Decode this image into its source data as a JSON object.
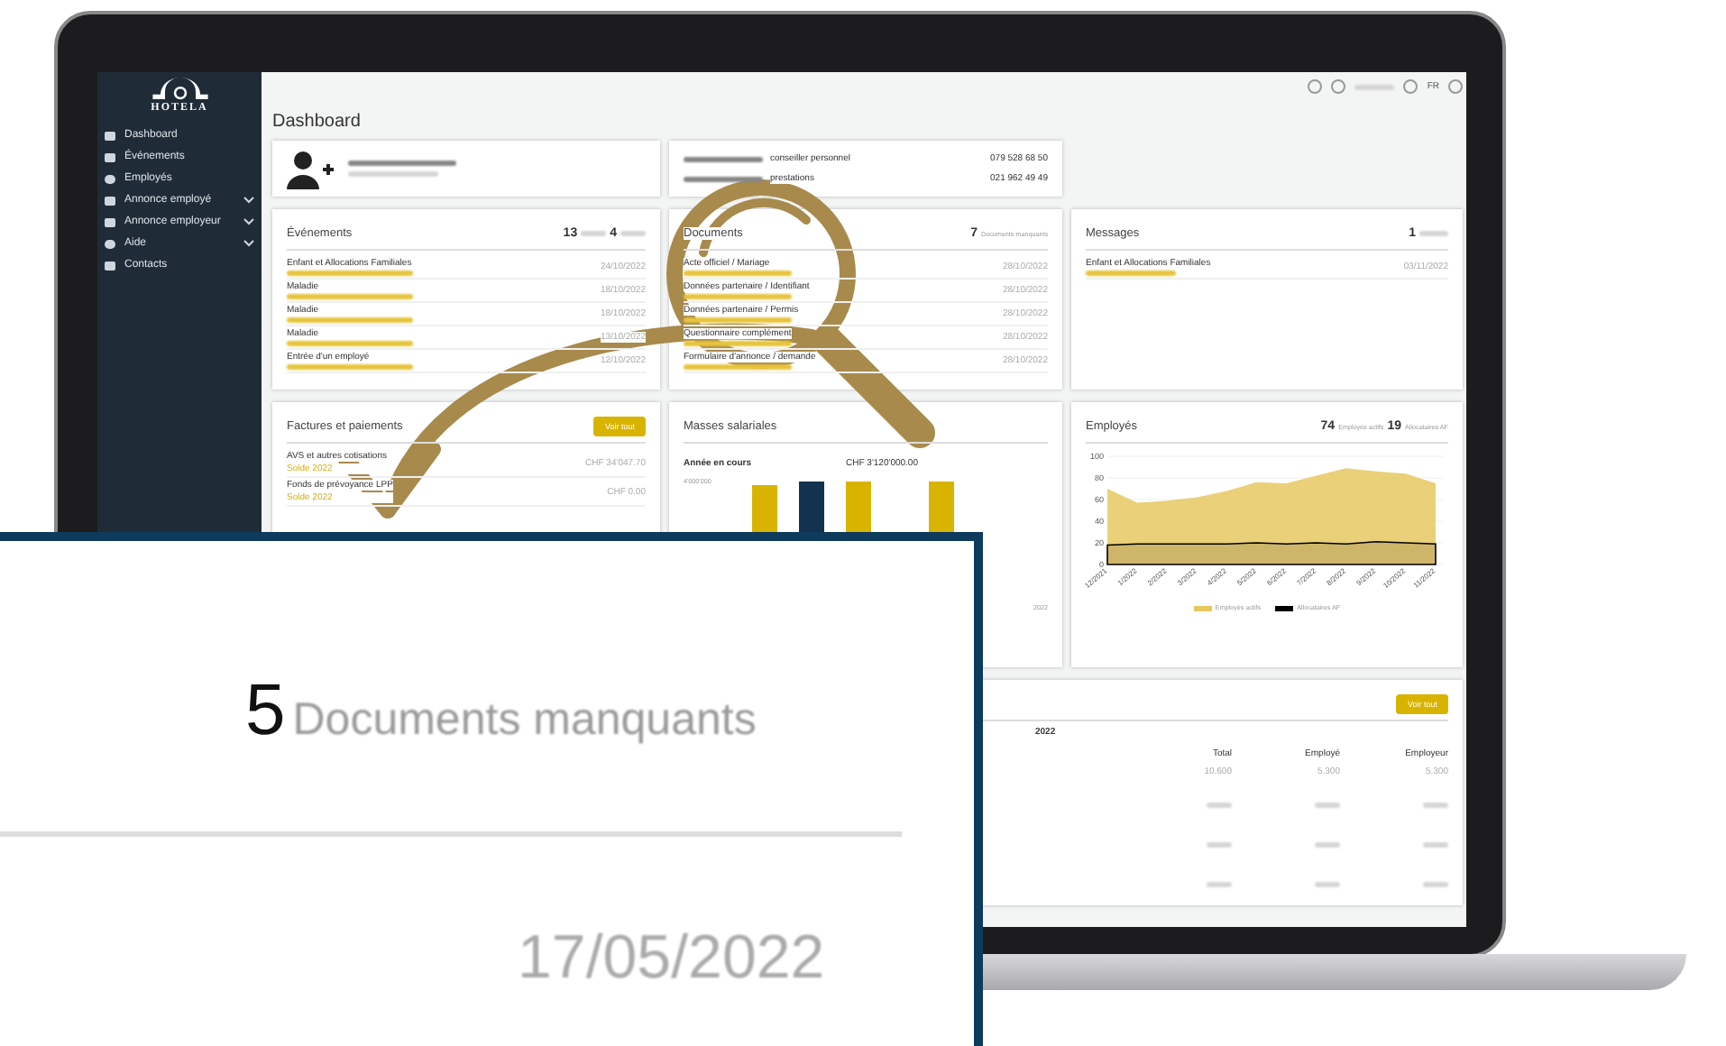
{
  "sidebar": {
    "logo": "HOTELA",
    "items": [
      {
        "label": "Dashboard",
        "expandable": false
      },
      {
        "label": "Événements",
        "expandable": false
      },
      {
        "label": "Employés",
        "expandable": false
      },
      {
        "label": "Annonce employé",
        "expandable": true
      },
      {
        "label": "Annonce employeur",
        "expandable": true
      },
      {
        "label": "Aide",
        "expandable": true
      },
      {
        "label": "Contacts",
        "expandable": false
      }
    ]
  },
  "topbar": {
    "language": "FR"
  },
  "page_title": "Dashboard",
  "advisor_card": {
    "rows": [
      {
        "role": "conseiller personnel",
        "phone": "079 528 68 50"
      },
      {
        "role": "prestations",
        "phone": "021 962 49 49"
      }
    ]
  },
  "events": {
    "title": "Événements",
    "counts": [
      "13",
      "4"
    ],
    "rows": [
      {
        "label": "Enfant et Allocations Familiales",
        "date": "24/10/2022"
      },
      {
        "label": "Maladie",
        "date": "18/10/2022"
      },
      {
        "label": "Maladie",
        "date": "18/10/2022"
      },
      {
        "label": "Maladie",
        "date": "13/10/2022"
      },
      {
        "label": "Entrée d'un employé",
        "date": "12/10/2022"
      }
    ]
  },
  "documents": {
    "title": "Documents",
    "count": "7",
    "count_label": "Documents manquants",
    "rows": [
      {
        "label": "Acte officiel / Mariage",
        "date": "28/10/2022"
      },
      {
        "label": "Données partenaire / Identifiant",
        "date": "28/10/2022"
      },
      {
        "label": "Données partenaire / Permis",
        "date": "28/10/2022"
      },
      {
        "label": "Questionnaire complément",
        "date": "28/10/2022"
      },
      {
        "label": "Formulaire d'annonce / demande",
        "date": "28/10/2022"
      }
    ]
  },
  "messages": {
    "title": "Messages",
    "count": "1",
    "rows": [
      {
        "label": "Enfant et Allocations Familiales",
        "date": "03/11/2022"
      }
    ]
  },
  "invoices": {
    "title": "Factures et paiements",
    "button": "Voir tout",
    "rows": [
      {
        "label": "AVS et autres cotisations",
        "sub": "Solde 2022",
        "amount": "CHF 34'047.70"
      },
      {
        "label": "Fonds de prévoyance LPP",
        "sub": "Solde 2022",
        "amount": "CHF 0.00"
      }
    ]
  },
  "payroll": {
    "title": "Masses salariales",
    "period": "Année en cours",
    "amount": "CHF 3'120'000.00",
    "axis_label": "4'000'000",
    "x_label": "2022"
  },
  "employees": {
    "title": "Employés",
    "counts": [
      {
        "value": "74"
      },
      {
        "value": "19"
      }
    ],
    "chart_data": {
      "type": "area",
      "categories": [
        "12/2021",
        "1/2022",
        "2/2022",
        "3/2022",
        "4/2022",
        "5/2022",
        "6/2022",
        "7/2022",
        "8/2022",
        "9/2022",
        "10/2022",
        "11/2022"
      ],
      "ylim": [
        0,
        100
      ],
      "grid": true,
      "legend": "bottom",
      "yticks": [
        0,
        20,
        40,
        60,
        80,
        100
      ],
      "series": [
        {
          "name": "Employés actifs",
          "color": "#e6c860",
          "values": [
            70,
            57,
            59,
            62,
            68,
            76,
            75,
            82,
            89,
            86,
            84,
            75
          ]
        },
        {
          "name": "Allocataires AF",
          "color": "#000000",
          "values": [
            18,
            19,
            19,
            19,
            19,
            20,
            19,
            20,
            19,
            21,
            20,
            19
          ]
        }
      ]
    }
  },
  "contributions": {
    "button": "Voir tout",
    "year": "2022",
    "columns": [
      "Total",
      "Employé",
      "Employeur"
    ],
    "first_row": [
      "10.600",
      "5.300",
      "5.300"
    ]
  },
  "callout": {
    "count": "5",
    "label": "Documents manquants",
    "date": "17/05/2022"
  }
}
